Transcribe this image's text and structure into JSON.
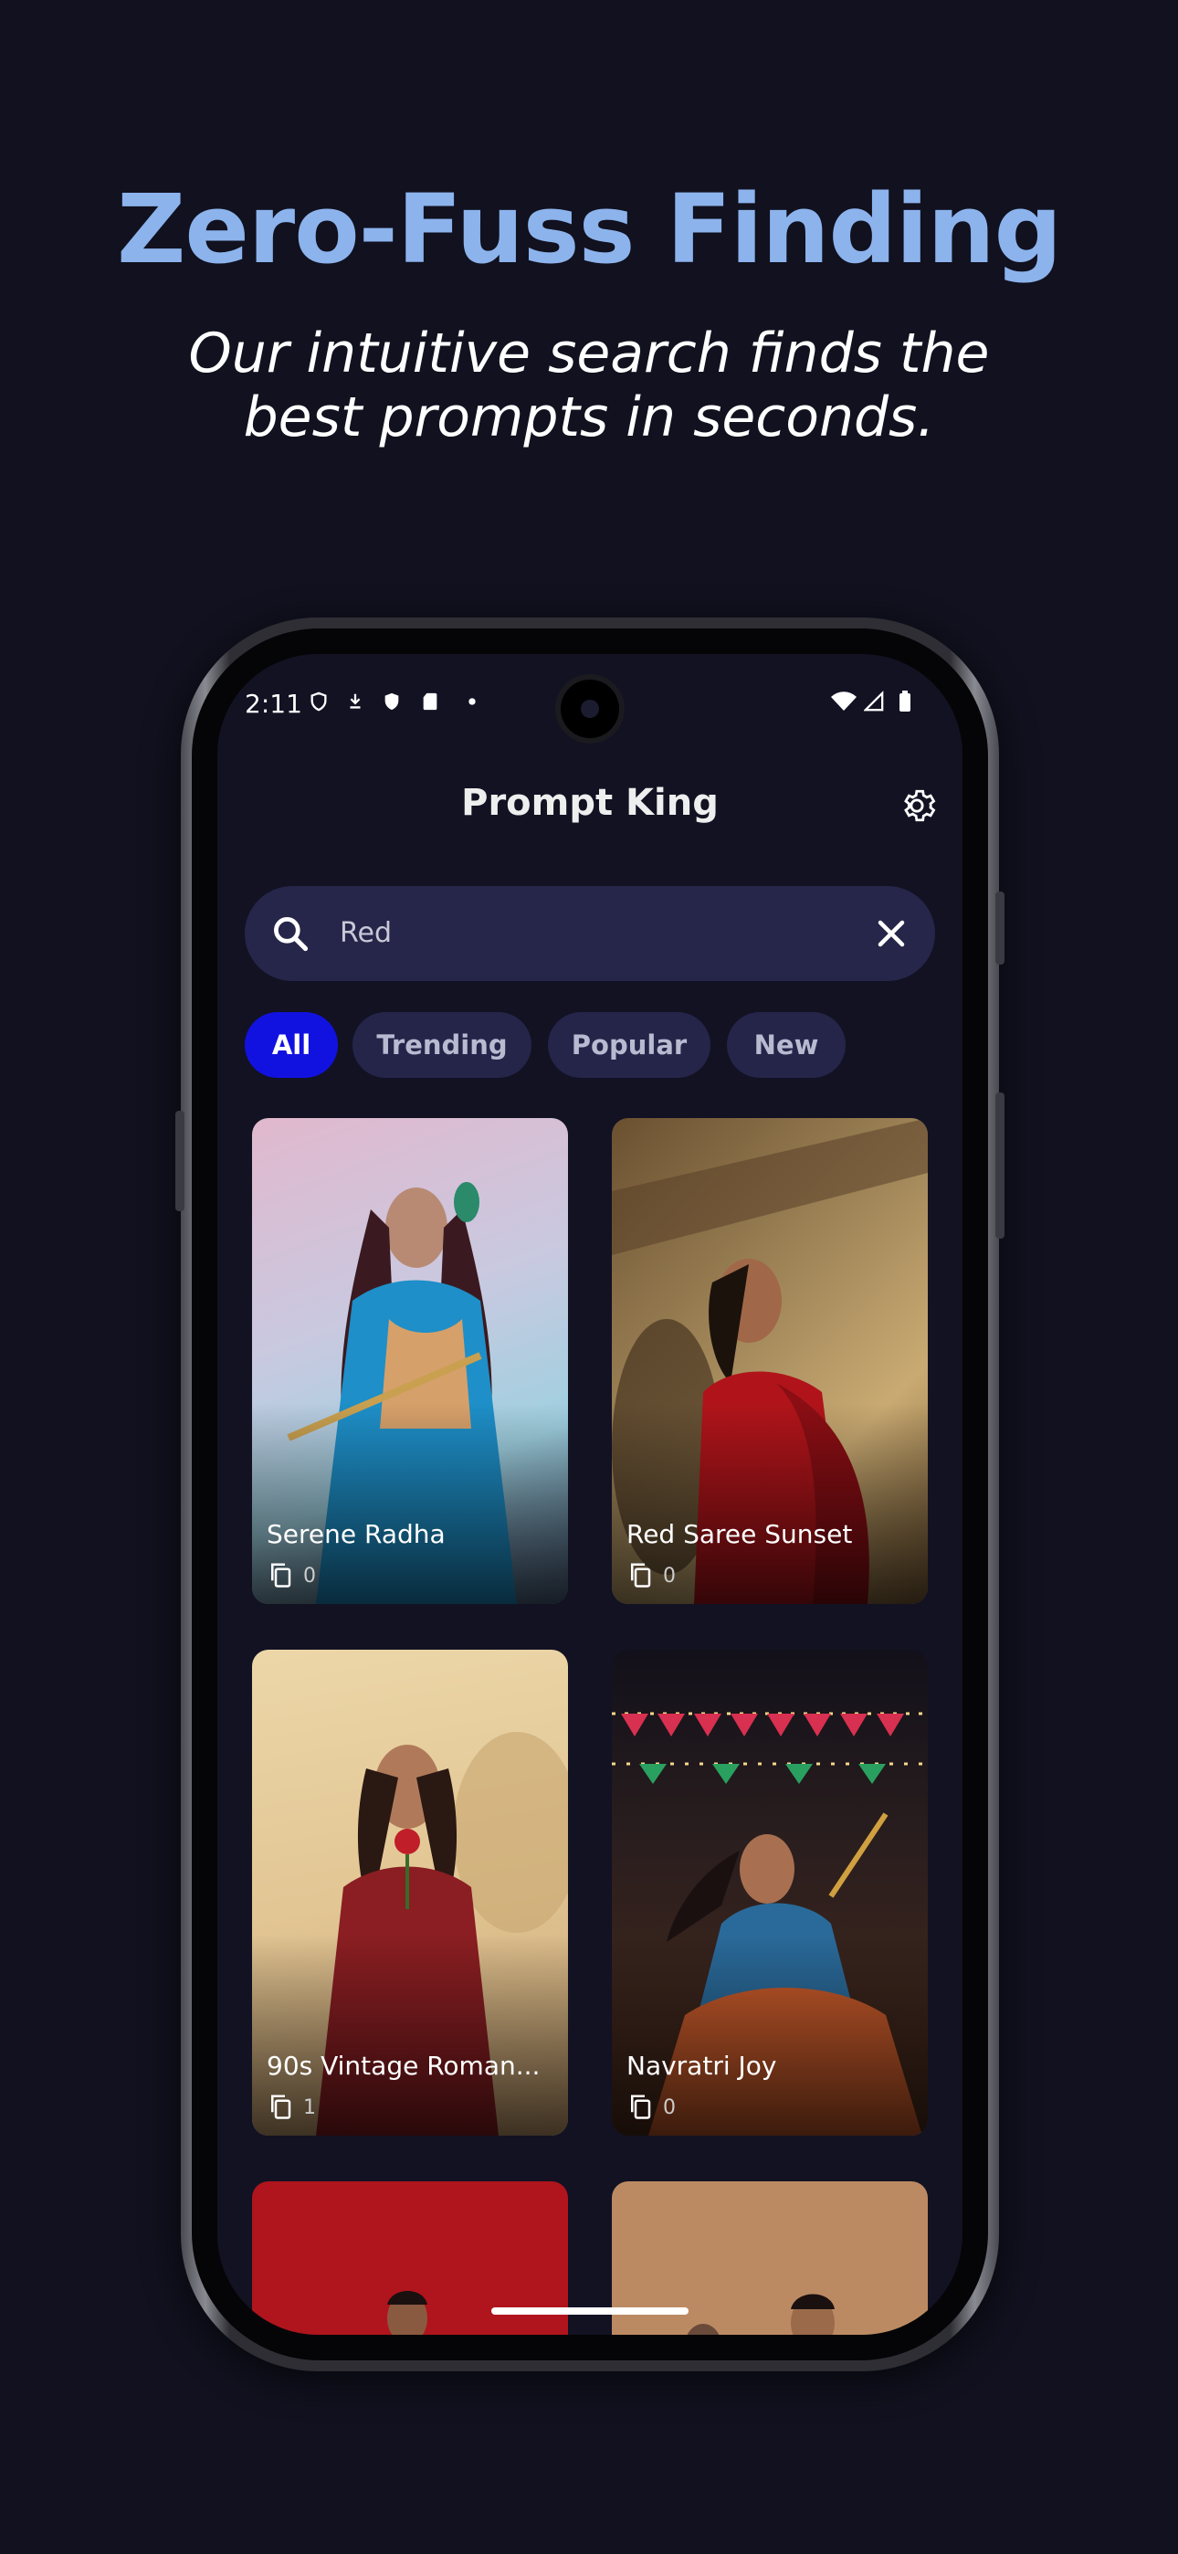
{
  "promo": {
    "headline": "Zero-Fuss Finding",
    "subline_1": "Our intuitive search finds the",
    "subline_2": "best prompts in seconds."
  },
  "status": {
    "time": "2:11",
    "left_icons": [
      "shield-outline-icon",
      "download-icon",
      "shield-filled-icon",
      "sd-card-icon",
      "dot-icon"
    ],
    "right_icons": [
      "wifi-icon",
      "signal-icon",
      "battery-icon"
    ]
  },
  "app": {
    "title": "Prompt King",
    "settings_icon": "gear-icon"
  },
  "search": {
    "value": "Red",
    "search_icon": "search-icon",
    "clear_icon": "close-icon"
  },
  "filters": {
    "items": [
      {
        "label": "All",
        "active": true
      },
      {
        "label": "Trending",
        "active": false
      },
      {
        "label": "Popular",
        "active": false
      },
      {
        "label": "New",
        "active": false
      }
    ]
  },
  "cards": [
    {
      "title": "Serene Radha",
      "count": "0"
    },
    {
      "title": "Red Saree Sunset",
      "count": "0"
    },
    {
      "title": "90s Vintage Roman...",
      "count": "1"
    },
    {
      "title": "Navratri Joy",
      "count": "0"
    }
  ],
  "colors": {
    "background": "#11111f",
    "accent_headline": "#8cb3ec",
    "chip_active": "#1212e0",
    "chip_inactive": "#25254a",
    "search_bg": "#26264a"
  }
}
